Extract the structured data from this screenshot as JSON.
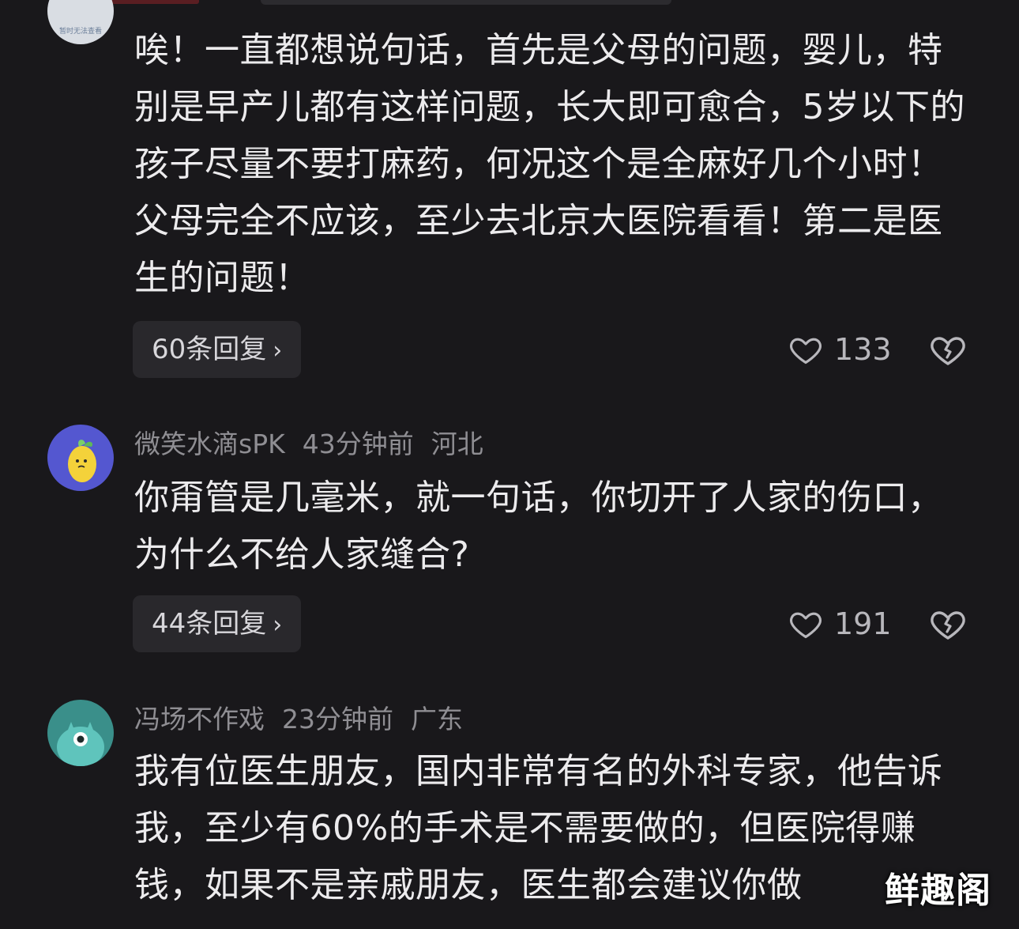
{
  "comments": [
    {
      "avatar_caption": "暂时无法查看",
      "text": "唉！一直都想说句话，首先是父母的问题，婴儿，特别是早产儿都有这样问题，长大即可愈合，5岁以下的孩子尽量不要打麻药，何况这个是全麻好几个小时！父母完全不应该，至少去北京大医院看看！第二是医生的问题！",
      "replies_label": "60条回复",
      "likes": "133"
    },
    {
      "username": "微笑水滴sPK",
      "time": "43分钟前",
      "location": "河北",
      "text": "你甭管是几毫米，就一句话，你切开了人家的伤口，为什么不给人家缝合?",
      "replies_label": "44条回复",
      "likes": "191"
    },
    {
      "username": "冯场不作戏",
      "time": "23分钟前",
      "location": "广东",
      "text": "我有位医生朋友，国内非常有名的外科专家，他告诉我，至少有60%的手术是不需要做的，但医院得赚钱，如果不是亲戚朋友，医生都会建议你做"
    }
  ],
  "icons": {
    "chevron": "›",
    "like": "heart-outline-icon",
    "dislike": "broken-heart-icon"
  },
  "watermark": "鲜趣阁",
  "colors": {
    "background": "#19181b",
    "text": "#ecebed",
    "meta": "#8f8e93",
    "button_bg": "#29282c"
  }
}
